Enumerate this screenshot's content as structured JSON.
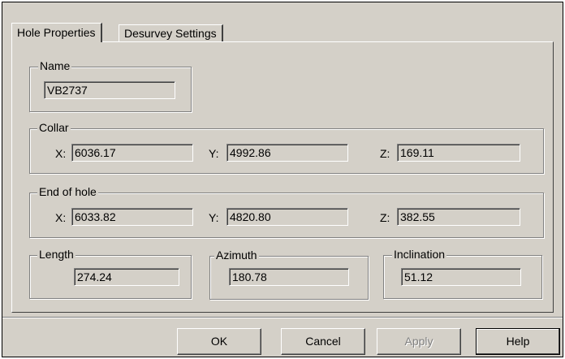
{
  "tabs": [
    {
      "label": "Hole Properties",
      "active": true
    },
    {
      "label": "Desurvey Settings",
      "active": false
    }
  ],
  "name_group": {
    "legend": "Name",
    "value": "VB2737"
  },
  "collar": {
    "legend": "Collar",
    "x_label": "X:",
    "x": "6036.17",
    "y_label": "Y:",
    "y": "4992.86",
    "z_label": "Z:",
    "z": "169.11"
  },
  "end_of_hole": {
    "legend": "End of hole",
    "x_label": "X:",
    "x": "6033.82",
    "y_label": "Y:",
    "y": "4820.80",
    "z_label": "Z:",
    "z": "382.55"
  },
  "length": {
    "legend": "Length",
    "value": "274.24"
  },
  "azimuth": {
    "legend": "Azimuth",
    "value": "180.78"
  },
  "inclination": {
    "legend": "Inclination",
    "value": "51.12"
  },
  "buttons": {
    "ok": "OK",
    "cancel": "Cancel",
    "apply": "Apply",
    "help": "Help"
  }
}
